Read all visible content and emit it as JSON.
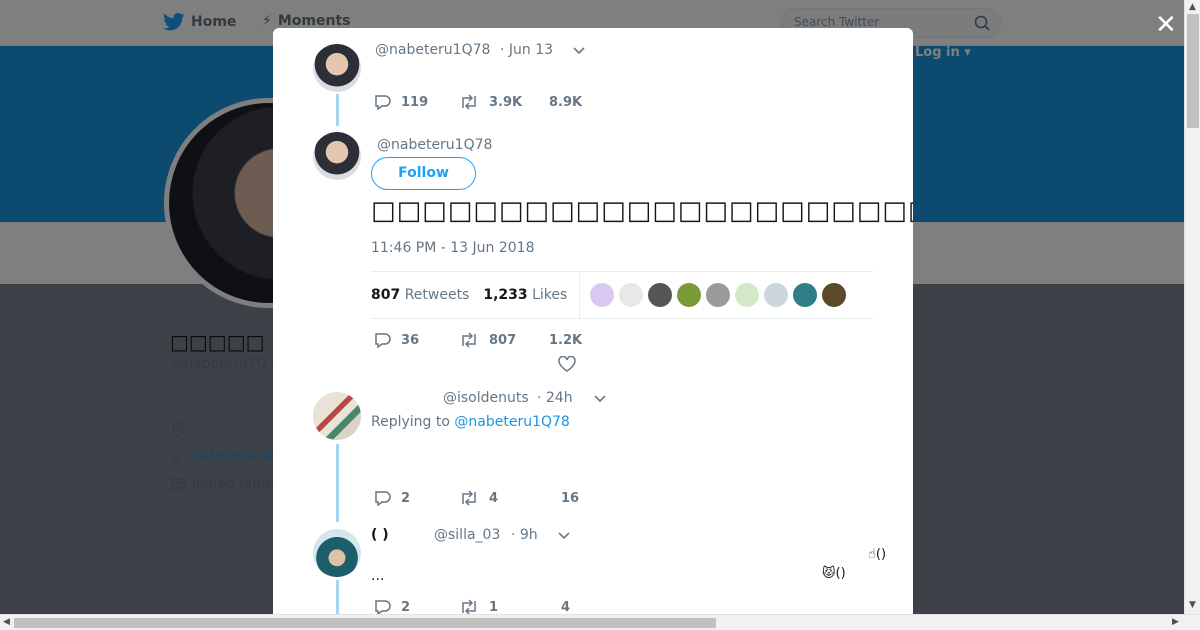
{
  "topnav": {
    "home_label": "Home",
    "moments_label": "Moments",
    "search_placeholder": "Search Twitter",
    "login_label": "Log in ▾"
  },
  "profile": {
    "name": "□□□□□",
    "handle": "@nabeteru1Q7",
    "url": "nabeteru.se",
    "joined": "Joined Janua"
  },
  "modal": {
    "parent_tweet": {
      "handle": "@nabeteru1Q78",
      "time": "· Jun 13",
      "replies": "119",
      "retweets": "3.9K",
      "likes": "8.9K"
    },
    "main_tweet": {
      "handle": "@nabeteru1Q78",
      "follow_label": "Follow",
      "text": "□□□□□□□□□□□□□□□□□□□□□□□□□□□□□□□□□□□□□□□□□□□□□□□□□",
      "timestamp": "11:46 PM - 13 Jun 2018",
      "retweets_count": "807",
      "retweets_label": "Retweets",
      "likes_count": "1,233",
      "likes_label": "Likes",
      "replies": "36",
      "retweets": "807",
      "likes": "1.2K"
    },
    "reply_1": {
      "handle": "@isoldenuts",
      "time": "· 24h",
      "replying_prefix": "Replying to",
      "replying_to": "@nabeteru1Q78",
      "replies": "2",
      "retweets": "4",
      "likes": "16"
    },
    "reply_2": {
      "name": "( )",
      "handle": "@silla_03",
      "time": "· 9h",
      "text": "...",
      "emoji_1": "☝()",
      "emoji_2": "😾()",
      "replies": "2",
      "retweets": "1",
      "likes": "4"
    },
    "liker_colors": [
      "#d9c9f0",
      "#e8e8e8",
      "#555555",
      "#7a9a3a",
      "#9a9a9a",
      "#d4e8c8",
      "#ccd6dd",
      "#2f7f86",
      "#5a4a2a"
    ]
  },
  "colors": {
    "accent": "#1da1f2",
    "banner": "#1b95e0",
    "thread": "#a6d4f2"
  }
}
